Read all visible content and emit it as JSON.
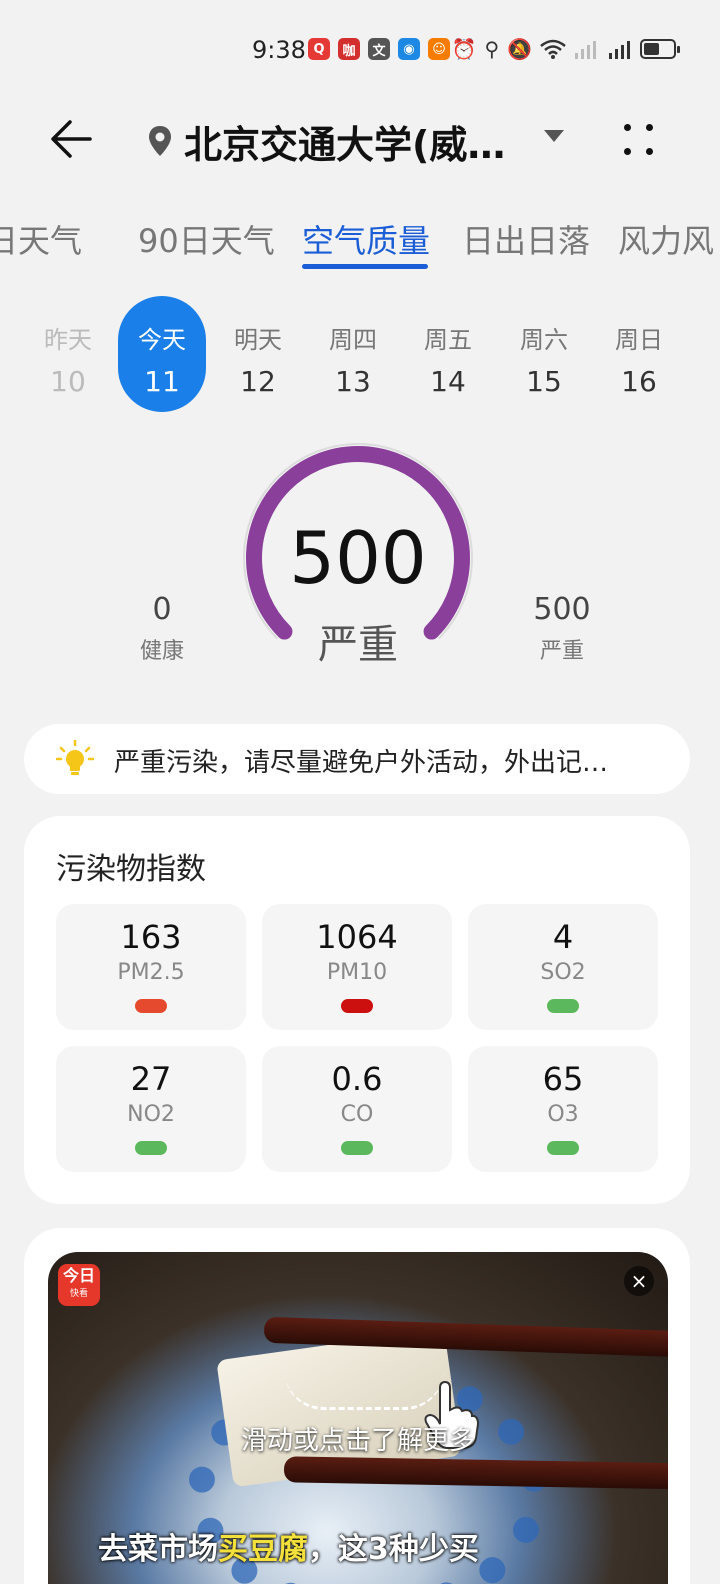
{
  "status_bar": {
    "time": "9:38",
    "apps": [
      {
        "icon": "search-app-icon",
        "glyph": "Q",
        "color": "#e53935"
      },
      {
        "icon": "news-app-icon",
        "glyph": "咖",
        "color": "#d32f2f"
      },
      {
        "icon": "translate-app-icon",
        "glyph": "文",
        "color": "#555555"
      },
      {
        "icon": "chat-app-icon",
        "glyph": "◉",
        "color": "#1e88e5"
      },
      {
        "icon": "avatar-app-icon",
        "glyph": "☺",
        "color": "#f57c00"
      }
    ],
    "battery_level": 0.55
  },
  "header": {
    "title": "北京交通大学(威…"
  },
  "tabs": [
    {
      "label": "日天气"
    },
    {
      "label": "90日天气"
    },
    {
      "label": "空气质量",
      "active": true
    },
    {
      "label": "日出日落"
    },
    {
      "label": "风力风"
    }
  ],
  "days": [
    {
      "name": "昨天",
      "date": "10",
      "state": "past"
    },
    {
      "name": "今天",
      "date": "11",
      "state": "active"
    },
    {
      "name": "明天",
      "date": "12"
    },
    {
      "name": "周四",
      "date": "13"
    },
    {
      "name": "周五",
      "date": "14"
    },
    {
      "name": "周六",
      "date": "15"
    },
    {
      "name": "周日",
      "date": "16"
    }
  ],
  "aqi": {
    "value": "500",
    "level": "严重",
    "fill_fraction": 1.0,
    "color": "#8a3f9a",
    "min_value": "0",
    "min_label": "健康",
    "max_value": "500",
    "max_label": "严重"
  },
  "advice": {
    "icon": "lightbulb-icon",
    "text": "严重污染，请尽量避免户外活动，外出记…"
  },
  "pollutants": {
    "title": "污染物指数",
    "items": [
      {
        "value": "163",
        "name": "PM2.5",
        "color": "#e64a2e"
      },
      {
        "value": "1064",
        "name": "PM10",
        "color": "#cc1010"
      },
      {
        "value": "4",
        "name": "SO2",
        "color": "#5cb85c"
      },
      {
        "value": "27",
        "name": "NO2",
        "color": "#5cb85c"
      },
      {
        "value": "0.6",
        "name": "CO",
        "color": "#5cb85c"
      },
      {
        "value": "65",
        "name": "O3",
        "color": "#5cb85c"
      }
    ]
  },
  "ad": {
    "logo_main": "今日",
    "logo_sub": "快看",
    "cta": "滑动或点击了解更多",
    "caption_pre": "去菜市场",
    "caption_highlight": "买豆腐",
    "caption_post": "，这3种少买",
    "close_glyph": "×"
  }
}
